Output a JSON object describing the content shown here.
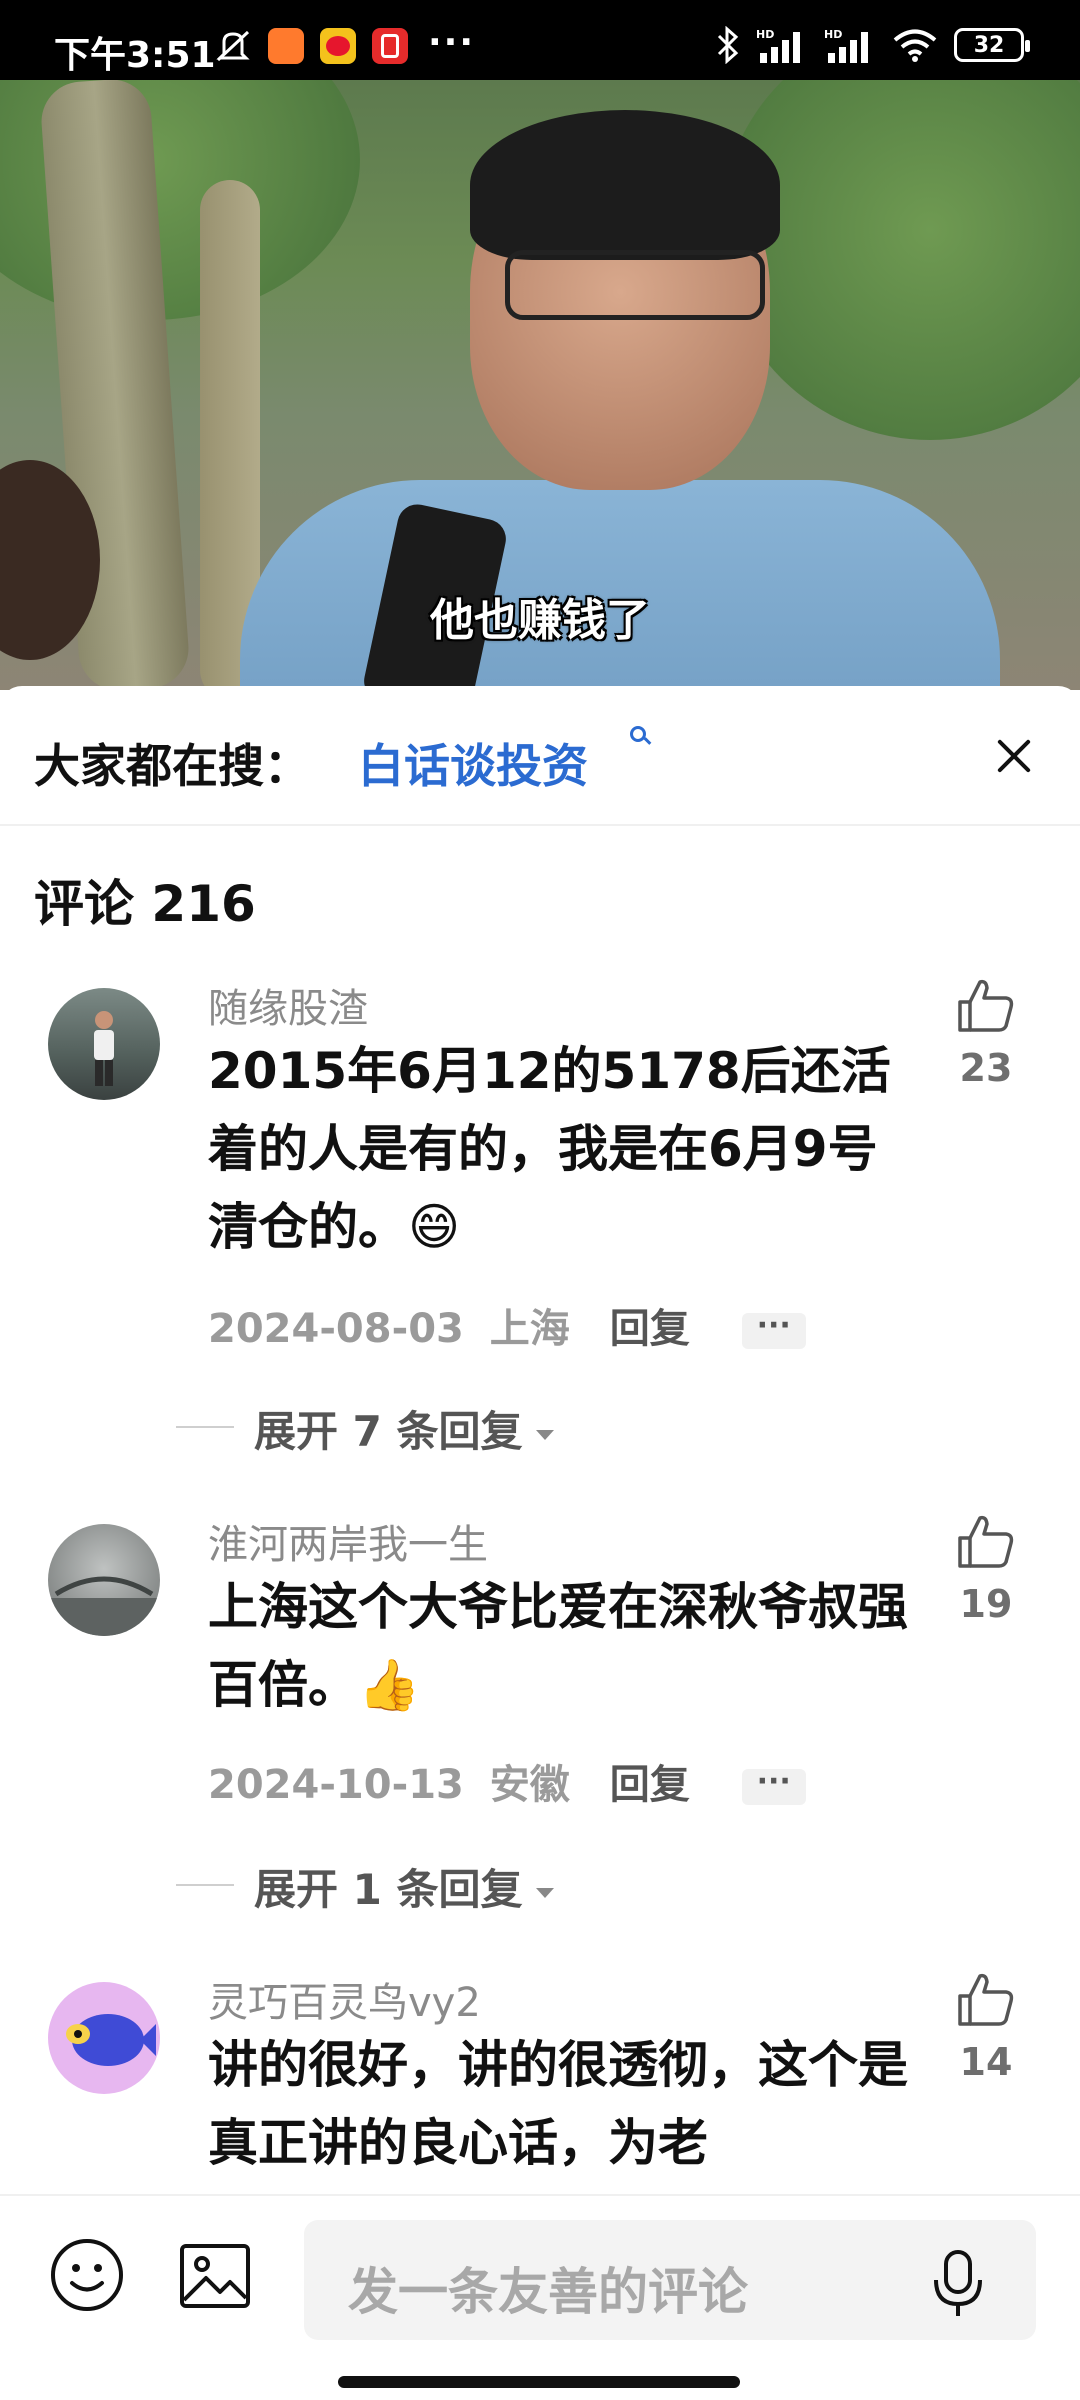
{
  "status_bar": {
    "time": "下午3:51",
    "overflow": "···",
    "battery": "32",
    "icons": [
      "mute-icon",
      "taobao-app-icon",
      "weibo-app-icon",
      "taobao-red-app-icon",
      "bluetooth-icon",
      "signal-hd-icon",
      "signal-hd-icon",
      "wifi-icon",
      "battery-icon"
    ]
  },
  "video": {
    "subtitle": "他也赚钱了"
  },
  "search_suggest": {
    "prefix": "大家都在搜：",
    "term": "白话谈投资"
  },
  "comments_header": {
    "label": "评论 216"
  },
  "comments": [
    {
      "user": "随缘股渣",
      "text": "2015年6月12的5178后还活着的人是有的，我是在6月9号清仓的。😄",
      "date": "2024-08-03",
      "location": "上海",
      "reply": "回复",
      "more": "···",
      "likes": "23",
      "expand": "展开 7 条回复"
    },
    {
      "user": "淮河两岸我一生",
      "text": "上海这个大爷比爱在深秋爷叔强百倍。👍",
      "date": "2024-10-13",
      "location": "安徽",
      "reply": "回复",
      "more": "···",
      "likes": "19",
      "expand": "展开 1 条回复"
    },
    {
      "user": "灵巧百灵鸟vy2",
      "text": "讲的很好，讲的很透彻，这个是真正讲的良心话，为老",
      "likes": "14"
    }
  ],
  "composer": {
    "placeholder": "发一条友善的评论"
  }
}
